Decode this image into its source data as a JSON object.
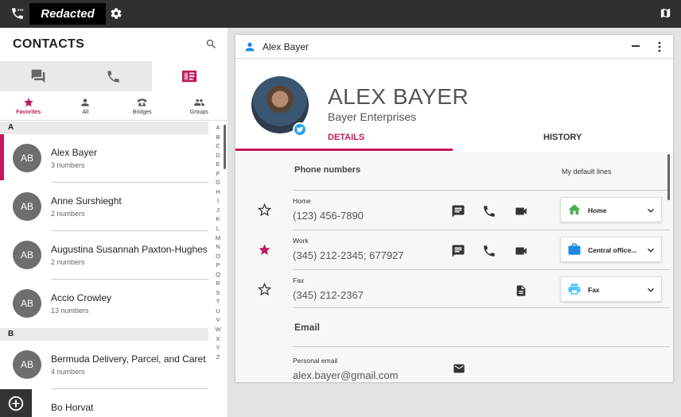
{
  "topbar": {
    "redacted_label": "Redacted"
  },
  "contacts": {
    "title": "CONTACTS",
    "subtabs": [
      "Favorites",
      "All",
      "Bridges",
      "Groups"
    ],
    "sections": [
      {
        "letter": "A",
        "items": [
          {
            "initials": "AB",
            "name": "Alex Bayer",
            "sub": "3 numbers"
          },
          {
            "initials": "AB",
            "name": "Anne Surshieght",
            "sub": "2 numbers"
          },
          {
            "initials": "AB",
            "name": "Augustina Susannah Paxton-Hughes...",
            "sub": "2 numbers"
          },
          {
            "initials": "AB",
            "name": "Accio Crowley",
            "sub": "13 numbers"
          }
        ]
      },
      {
        "letter": "B",
        "items": [
          {
            "initials": "AB",
            "name": "Bermuda Delivery, Parcel, and Caret...",
            "sub": "4 numbers"
          },
          {
            "initials": "",
            "name": "Bo Horvat",
            "sub": ""
          }
        ]
      }
    ],
    "alphabet": [
      "A",
      "B",
      "C",
      "D",
      "E",
      "F",
      "G",
      "H",
      "I",
      "J",
      "K",
      "L",
      "M",
      "N",
      "O",
      "P",
      "Q",
      "R",
      "S",
      "T",
      "U",
      "V",
      "W",
      "X",
      "Y",
      "Z"
    ]
  },
  "detail": {
    "window_title": "Alex Bayer",
    "name": "ALEX BAYER",
    "company": "Bayer Enterprises",
    "tabs": {
      "details": "DETAILS",
      "history": "HISTORY"
    },
    "phone_section": "Phone numbers",
    "default_lines_label": "My default lines",
    "phones": [
      {
        "label": "Home",
        "value": "(123) 456-7890",
        "favorite": false,
        "line": "Home"
      },
      {
        "label": "Work",
        "value": "(345) 212-2345; 677927",
        "favorite": true,
        "line": "Central office..."
      },
      {
        "label": "Fax",
        "value": "(345) 212-2367",
        "favorite": false,
        "line": "Fax"
      }
    ],
    "email_section": "Email",
    "email": {
      "label": "Personal email",
      "value": "alex.bayer@gmail.com"
    }
  },
  "colors": {
    "accent": "#c2185b",
    "topbar": "#303030",
    "work_icon": "#1e88e5",
    "home_icon": "#4caf50",
    "fax_icon": "#4fc3f7"
  }
}
